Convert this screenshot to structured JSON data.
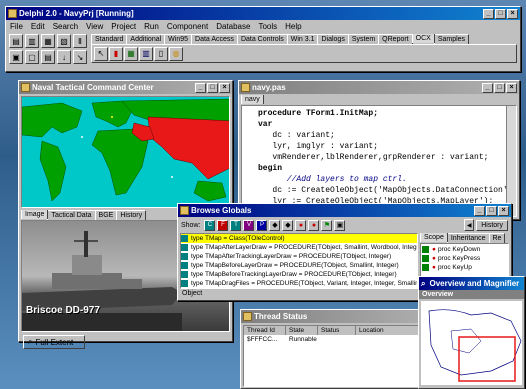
{
  "ide": {
    "title": "Delphi 2.0 - NavyPrj [Running]",
    "menu": [
      "File",
      "Edit",
      "Search",
      "View",
      "Project",
      "Run",
      "Component",
      "Database",
      "Tools",
      "Help"
    ],
    "palette_tabs": [
      "Standard",
      "Additional",
      "Win95",
      "Data Access",
      "Data Controls",
      "Win 3.1",
      "Dialogs",
      "System",
      "QReport",
      "OCX",
      "Samples"
    ],
    "active_tab": "OCX"
  },
  "map_window": {
    "title": "Naval Tactical Command Center",
    "tabs": [
      "Image",
      "Tactical Data",
      "BGE",
      "History"
    ],
    "ship_label": "Briscoe DD-977",
    "full_extent_button": "Full Extent"
  },
  "editor": {
    "title": "navy.pas",
    "tab": "navy",
    "lines": [
      {
        "kind": "kw",
        "text": "procedure TForm1.InitMap;"
      },
      {
        "kind": "kw",
        "text": "var"
      },
      {
        "kind": "plain",
        "text": "   dc : variant;"
      },
      {
        "kind": "plain",
        "text": "   lyr, imglyr : variant;"
      },
      {
        "kind": "plain",
        "text": "   vmRenderer,lblRenderer,grpRenderer : variant;"
      },
      {
        "kind": "kw",
        "text": "begin"
      },
      {
        "kind": "cm",
        "text": "      //Add layers to map ctrl."
      },
      {
        "kind": "plain",
        "text": "   dc := CreateOleObject('MapObjects.DataConnection');"
      },
      {
        "kind": "plain",
        "text": "   lyr := CreateOleObject('MapObjects.MapLayer');"
      },
      {
        "kind": "plain",
        "text": "   imglyr := CreateOleObject('MapObjects.ImageLayer');"
      }
    ]
  },
  "browse": {
    "title": "Browse Globals",
    "show_label": "Show:",
    "history_button": "History",
    "rows": [
      "type  TMap = Class(TOleControl)",
      "type  TMapAfterLayerDraw = PROCEDURE(TObject, Smallint, Wordbool, Integer)",
      "type  TMapAfterTrackingLayerDraw = PROCEDURE(TObject, Integer)",
      "type  TMapBeforeLayerDraw = PROCEDURE(TObject, Smallint, Integer)",
      "type  TMapBeforeTrackingLayerDraw = PROCEDURE(TObject, Integer)",
      "type  TMapDragFiles = PROCEDURE(TObject, Variant, Integer, Integer, Smallint, VAR W",
      "type  TMapDrawError = PROCEDURE(TObject, Smallint)"
    ],
    "object_label": "Object",
    "scope_tabs": [
      "Scope",
      "Inheritance",
      "Re"
    ],
    "scope_items": [
      "proc KeyDown",
      "proc KeyPress",
      "proc KeyUp"
    ]
  },
  "thread": {
    "title": "Thread Status",
    "headers": [
      "Thread Id",
      "State",
      "Status",
      "Location"
    ],
    "row": [
      "$FFFCC...",
      "Runnable",
      "",
      ""
    ]
  },
  "overview": {
    "title": "Overview and Magnifier",
    "subtitle": "Overview"
  },
  "colors": {
    "accent": "#000080",
    "selected_row": "#ffff00",
    "hostile": "#e81818",
    "map_sea": "#00c8c8",
    "map_land": "#00a000"
  }
}
